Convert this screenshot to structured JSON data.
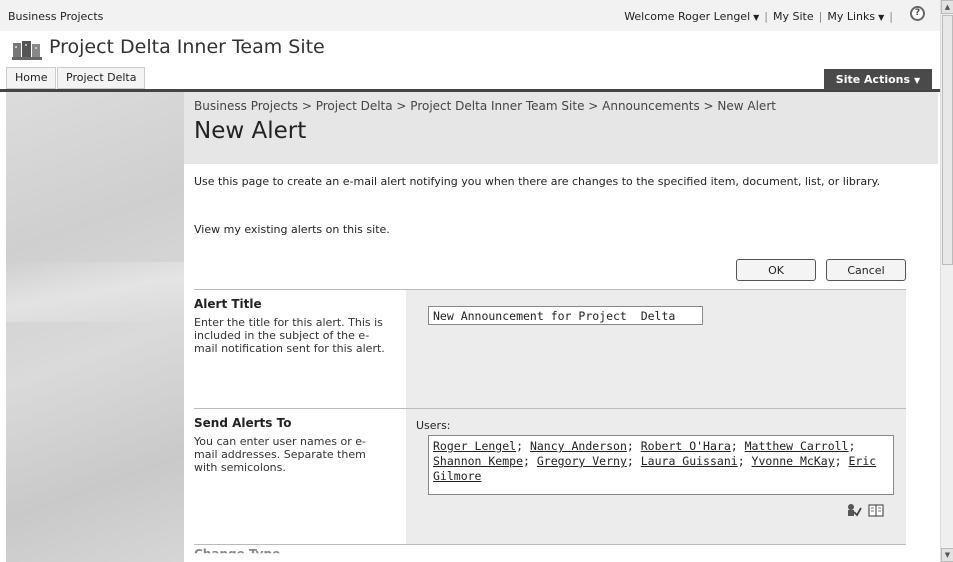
{
  "topbar": {
    "site_name": "Business Projects",
    "welcome": "Welcome Roger Lengel",
    "my_site": "My Site",
    "my_links": "My Links",
    "separator": "|",
    "dropdown_arrow": "▼",
    "help_glyph": "?"
  },
  "site": {
    "title": "Project Delta Inner Team Site"
  },
  "nav": {
    "home": "Home",
    "project_delta": "Project Delta",
    "site_actions": "Site Actions",
    "site_actions_arrow": "▼"
  },
  "page": {
    "breadcrumb": "Business Projects > Project Delta > Project Delta Inner Team Site > Announcements > New Alert",
    "title": "New Alert",
    "description": "Use this page to create an e-mail alert notifying you when there are changes to the specified item, document, list, or library.",
    "existing_alerts_link": "View my existing alerts on this site."
  },
  "buttons": {
    "ok": "OK",
    "cancel": "Cancel"
  },
  "alert_title": {
    "heading": "Alert Title",
    "description": "Enter the title for this alert. This is included in the subject of the e-mail notification sent for this alert.",
    "value": "New Announcement for Project  Delta"
  },
  "send_alerts": {
    "heading": "Send Alerts To",
    "description": "You can enter user names or e-mail addresses. Separate them with semicolons.",
    "users_label": "Users:",
    "users": [
      "Roger Lengel",
      "Nancy Anderson",
      "Robert O'Hara",
      "Matthew Carroll",
      "Shannon Kempe",
      "Gregory Verny",
      "Laura Guissani",
      "Yvonne McKay",
      "Eric Gilmore"
    ],
    "separator": "; "
  },
  "next_section": {
    "heading": "Change Type"
  },
  "icons": {
    "help": "help-icon",
    "logo": "site-logo-icon",
    "check_names": "check-names-icon",
    "browse": "address-book-icon"
  }
}
